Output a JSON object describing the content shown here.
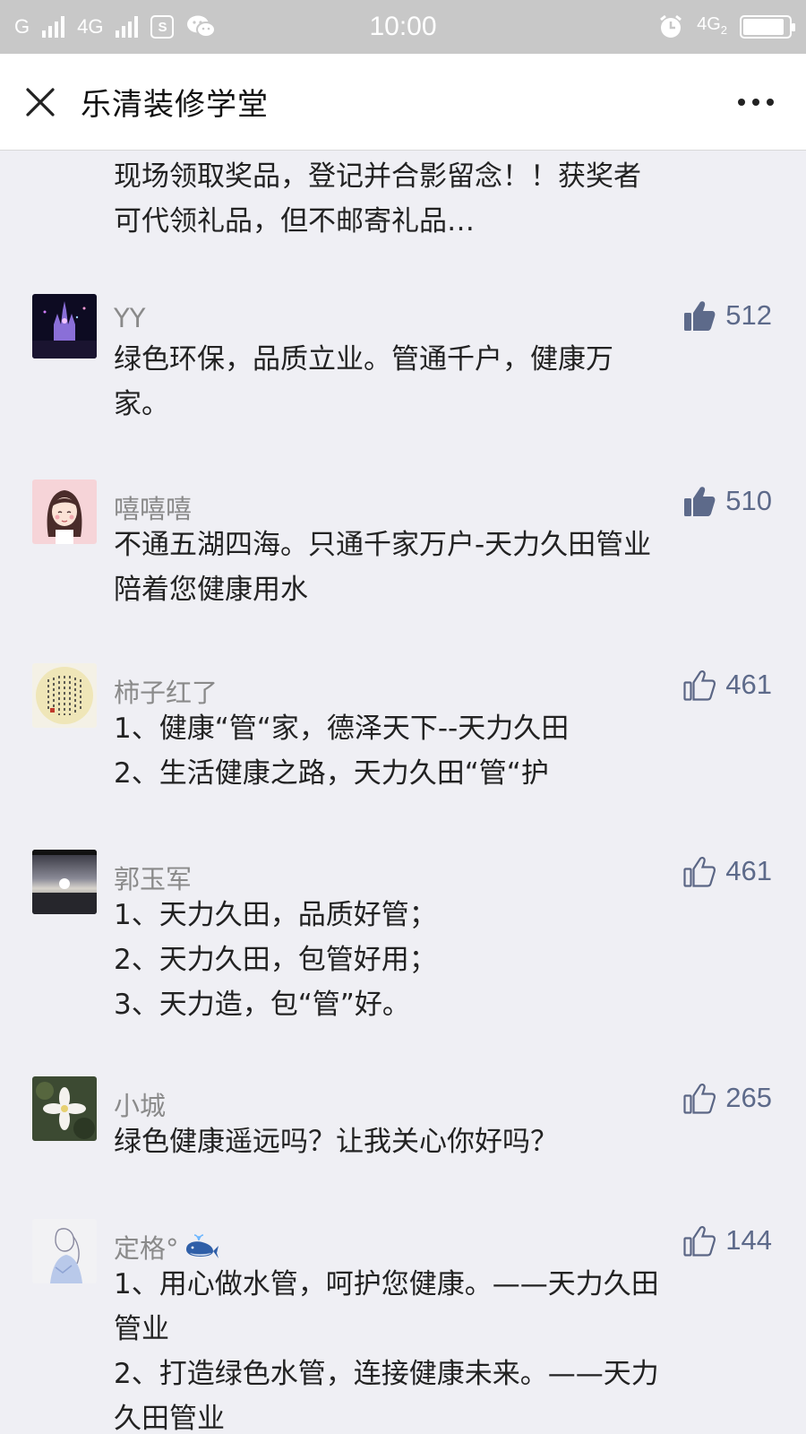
{
  "status_bar": {
    "carrier1": "G",
    "carrier2": "4G",
    "time": "10:00",
    "network_right": "4G",
    "sim_badge": "2",
    "battery_level": 0.9
  },
  "header": {
    "title": "乐清装修学堂",
    "close_icon": "close-icon",
    "more_icon": "more-icon"
  },
  "article_snippet": "现场领取奖品，登记并合影留念！！获奖者\n可代领礼品，但不邮寄礼品…",
  "comments": [
    {
      "nickname": "YY",
      "likes": "512",
      "liked": true,
      "text": "绿色环保，品质立业。管通千户，健康万\n家。"
    },
    {
      "nickname": "嘻嘻嘻",
      "likes": "510",
      "liked": true,
      "text": "不通五湖四海。只通千家万户-天力久田管业\n陪着您健康用水"
    },
    {
      "nickname": "柿子红了",
      "likes": "461",
      "liked": false,
      "text": "1、健康“管“家，德泽天下--天力久田\n2、生活健康之路，天力久田“管“护"
    },
    {
      "nickname": "郭玉军",
      "likes": "461",
      "liked": false,
      "text": "1、天力久田，品质好管；\n2、天力久田，包管好用；\n3、天力造，包“管”好。"
    },
    {
      "nickname": "小城",
      "likes": "265",
      "liked": false,
      "text": "绿色健康遥远吗？让我关心你好吗？"
    },
    {
      "nickname": "定格°",
      "likes": "144",
      "liked": false,
      "text": "1、用心做水管，呵护您健康。——天力久田\n管业\n2、打造绿色水管，连接健康未来。——天力\n久田管业"
    }
  ],
  "colors": {
    "status_bar_bg": "#c8c8c8",
    "page_bg": "#efeff4",
    "like_color": "#5d6a8a",
    "nickname_color": "#8a8a8a"
  }
}
